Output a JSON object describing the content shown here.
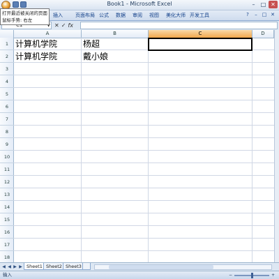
{
  "window": {
    "title": "Book1 - Microsoft Excel",
    "controls": [
      "–",
      "□",
      "✕"
    ]
  },
  "tooltip": {
    "line1": "打开最近被关闭的页面",
    "line2": "鼠标手势: 右左"
  },
  "ribbon": {
    "tabs": [
      "插入",
      "页面布局",
      "公式",
      "数据",
      "审阅",
      "视图",
      "美化大师",
      "开发工具"
    ]
  },
  "formula_bar": {
    "name_box": "C1",
    "name_box_icon": "chevron-down-icon",
    "cancel_symbol": "✕",
    "enter_symbol": "✓",
    "fx_symbol": "fx",
    "formula": ""
  },
  "columns": [
    "A",
    "B",
    "C",
    "D"
  ],
  "active_column": "C",
  "rows": [
    "1",
    "2",
    "3",
    "4",
    "5",
    "6",
    "7",
    "8",
    "9",
    "10",
    "11",
    "12",
    "13",
    "14",
    "15",
    "16",
    "17",
    "18"
  ],
  "cells": {
    "A1": "计算机学院",
    "B1": "杨超",
    "A2": "计算机学院",
    "B2": "戴小娘"
  },
  "selected_cell": "C1",
  "sheets": [
    "Sheet1",
    "Sheet2",
    "Sheet3"
  ],
  "active_sheet": "Sheet1",
  "status": {
    "mode": "输入"
  },
  "colors": {
    "accent_header": "#f1a74c",
    "grid_line": "#d0d7e5",
    "ribbon_blue": "#15428b"
  }
}
